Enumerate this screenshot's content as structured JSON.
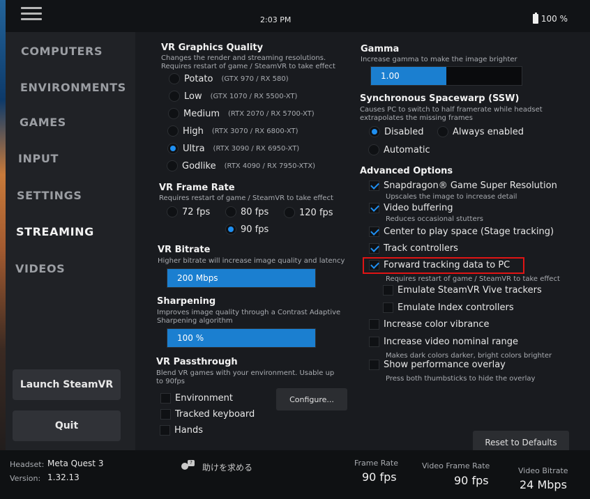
{
  "status": {
    "time": "2:03 PM",
    "battery": "100 %"
  },
  "sidebar": {
    "items": [
      {
        "label": "COMPUTERS"
      },
      {
        "label": "ENVIRONMENTS"
      },
      {
        "label": "GAMES"
      },
      {
        "label": "INPUT"
      },
      {
        "label": "SETTINGS"
      },
      {
        "label": "STREAMING",
        "active": true
      },
      {
        "label": "VIDEOS"
      }
    ],
    "launch_label": "Launch SteamVR",
    "quit_label": "Quit"
  },
  "left": {
    "vr_graphics": {
      "title": "VR Graphics Quality",
      "desc1": "Changes the render and streaming resolutions.",
      "desc2": "Requires restart of game / SteamVR to take effect",
      "options": [
        {
          "label": "Potato",
          "note": "(GTX 970 / RX 580)",
          "selected": false
        },
        {
          "label": "Low",
          "note": "(GTX 1070 / RX 5500-XT)",
          "selected": false
        },
        {
          "label": "Medium",
          "note": "(RTX 2070 / RX 5700-XT)",
          "selected": false
        },
        {
          "label": "High",
          "note": "(RTX 3070 / RX 6800-XT)",
          "selected": false
        },
        {
          "label": "Ultra",
          "note": "(RTX 3090 / RX 6950-XT)",
          "selected": true
        },
        {
          "label": "Godlike",
          "note": "(RTX 4090 / RX 7950-XTX)",
          "selected": false
        }
      ]
    },
    "frame_rate": {
      "title": "VR Frame Rate",
      "desc": "Requires restart of game / SteamVR to take effect",
      "options": [
        {
          "label": "72 fps",
          "selected": false
        },
        {
          "label": "80 fps",
          "selected": false
        },
        {
          "label": "120 fps",
          "selected": false
        },
        {
          "label": "90 fps",
          "selected": true
        }
      ]
    },
    "bitrate": {
      "title": "VR Bitrate",
      "desc": "Higher bitrate will increase image quality and latency",
      "value": "200 Mbps",
      "level": 1.0
    },
    "sharpening": {
      "title": "Sharpening",
      "desc1": "Improves image quality through a Contrast Adaptive",
      "desc2": "Sharpening algorithm",
      "value": "100 %",
      "level": 1.0
    },
    "passthrough": {
      "title": "VR Passthrough",
      "desc1": "Blend VR games with your environment. Usable up",
      "desc2": "to 90fps",
      "configure_label": "Configure...",
      "options": [
        {
          "label": "Environment",
          "checked": false
        },
        {
          "label": "Tracked keyboard",
          "checked": false
        },
        {
          "label": "Hands",
          "checked": false
        }
      ]
    },
    "reset_label": "Reset to Defaults"
  },
  "right": {
    "gamma": {
      "title": "Gamma",
      "desc": "Increase gamma to make the image brighter",
      "value": "1.00",
      "level": 0.5
    },
    "ssw": {
      "title": "Synchronous Spacewarp (SSW)",
      "desc1": "Causes PC to switch to half framerate while headset",
      "desc2": "extrapolates the missing frames",
      "options": [
        {
          "label": "Disabled",
          "selected": true
        },
        {
          "label": "Always enabled",
          "selected": false
        },
        {
          "label": "Automatic",
          "selected": false
        }
      ]
    },
    "advanced": {
      "title": "Advanced Options",
      "options": [
        {
          "label": "Snapdragon® Game Super Resolution",
          "sub": "Upscales the image to increase detail",
          "checked": true
        },
        {
          "label": "Video buffering",
          "sub": "Reduces occasional stutters",
          "checked": true
        },
        {
          "label": "Center to play space (Stage tracking)",
          "sub": "",
          "checked": true
        },
        {
          "label": "Track controllers",
          "sub": "",
          "checked": true
        },
        {
          "label": "Forward tracking data to PC",
          "sub": "Requires restart of game / SteamVR to take effect",
          "checked": true
        },
        {
          "label": "Emulate SteamVR Vive trackers",
          "sub": "",
          "checked": false
        },
        {
          "label": "Emulate Index controllers",
          "sub": "",
          "checked": false
        },
        {
          "label": "Increase color vibrance",
          "sub": "",
          "checked": false
        },
        {
          "label": "Increase video nominal range",
          "sub": "Makes dark colors darker, bright colors brighter",
          "checked": false
        },
        {
          "label": "Show performance overlay",
          "sub": "Press both thumbsticks to hide the overlay",
          "checked": false
        }
      ]
    }
  },
  "footer": {
    "headset_label": "Headset:",
    "headset_value": "Meta Quest 3",
    "version_label": "Version:",
    "version_value": "1.32.13",
    "help_label": "助けを求める",
    "help_badge": "?",
    "frame_rate_label": "Frame Rate",
    "frame_rate_value": "90 fps",
    "video_frame_rate_label": "Video Frame Rate",
    "video_frame_rate_value": "90 fps",
    "video_bitrate_label": "Video Bitrate",
    "video_bitrate_value": "24 Mbps"
  },
  "colors": {
    "accent": "#1f8ff1",
    "highlight": "#e01414",
    "background": "#191b1f"
  }
}
